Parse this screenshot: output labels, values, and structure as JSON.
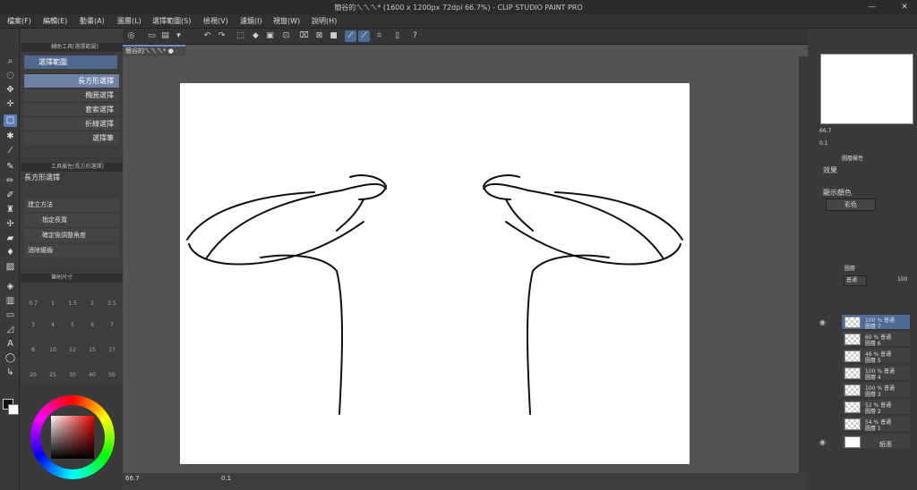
{
  "window": {
    "title": "簡谷的ㄟㄟㄟ* (1600 x 1200px 72dpi 66.7%)  - CLIP STUDIO PAINT PRO",
    "minimize": "—",
    "close": "✕"
  },
  "menu": [
    "檔案(F)",
    "編輯(E)",
    "動畫(A)",
    "圖層(L)",
    "選擇範圍(S)",
    "檢視(V)",
    "濾鏡(I)",
    "視窗(W)",
    "說明(H)"
  ],
  "tabs": {
    "document": "簡谷的ㄟㄟㄟ* ●",
    "subtool_panel": "輔助工具[選擇範圍]",
    "toolprop_panel": "工具屬性[長方形選擇]",
    "brushsize_panel": "筆刷尺寸",
    "layerprop_panel": "圖層屬性",
    "layer_panel": "圖層"
  },
  "subtool": {
    "group": "選擇範圍",
    "items": [
      "長方形選擇",
      "橢圓選擇",
      "套索選擇",
      "折線選擇",
      "選擇筆"
    ]
  },
  "toolprop": {
    "title": "長方形選擇",
    "rows": [
      "建立方法",
      "指定長寬",
      "確定後調整角度",
      "消除鋸齒"
    ]
  },
  "brushsize": {
    "values": [
      "0.7",
      "1",
      "1.5",
      "2",
      "2.5",
      "3",
      "4",
      "5",
      "6",
      "7",
      "8",
      "10",
      "12",
      "15",
      "17",
      "20",
      "25",
      "30",
      "40",
      "50"
    ]
  },
  "navigator": {
    "zoom": "66.7",
    "rotate": "0.1"
  },
  "layerprop": {
    "effect_label": "效果",
    "color_label": "顯示顏色",
    "color_value": "彩色"
  },
  "layerpanel": {
    "blend": "普通",
    "opacity": "100",
    "layers": [
      {
        "opacity": "100 % 普通",
        "name": "圖層 7",
        "selected": true,
        "visible": true
      },
      {
        "opacity": "60 % 普通",
        "name": "圖層 6",
        "selected": false,
        "visible": false
      },
      {
        "opacity": "46 % 普通",
        "name": "圖層 5",
        "selected": false,
        "visible": false
      },
      {
        "opacity": "100 % 普通",
        "name": "圖層 4",
        "selected": false,
        "visible": false
      },
      {
        "opacity": "100 % 普通",
        "name": "圖層 3",
        "selected": false,
        "visible": false
      },
      {
        "opacity": "52 % 普通",
        "name": "圖層 2",
        "selected": false,
        "visible": false
      },
      {
        "opacity": "54 % 普通",
        "name": "圖層 1",
        "selected": false,
        "visible": false
      }
    ],
    "paper": "紙張"
  },
  "status": {
    "zoom": "66.7",
    "rotate": "0.1"
  },
  "colors": {
    "accent": "#5a7db8",
    "panel": "#3d3d3d",
    "paper": "#ffffff"
  }
}
